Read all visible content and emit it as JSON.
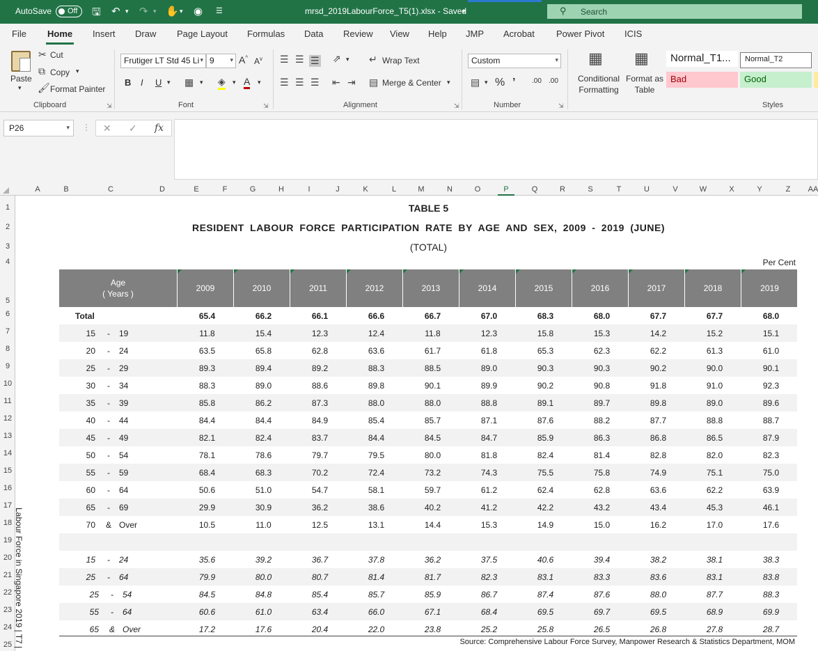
{
  "titlebar": {
    "autosave_label": "AutoSave",
    "autosave_state": "Off",
    "filename": "mrsd_2019LabourForce_T5(1).xlsx  -  Saved",
    "search_placeholder": "Search"
  },
  "menu": {
    "tabs": [
      "File",
      "Home",
      "Insert",
      "Draw",
      "Page Layout",
      "Formulas",
      "Data",
      "Review",
      "View",
      "Help",
      "JMP",
      "Acrobat",
      "Power Pivot",
      "ICIS"
    ],
    "active": "Home"
  },
  "ribbon": {
    "clipboard": {
      "paste": "Paste",
      "cut": "Cut",
      "copy": "Copy",
      "format_painter": "Format Painter",
      "label": "Clipboard"
    },
    "font": {
      "font_name": "Frutiger LT Std 45 Li",
      "font_size": "9",
      "label": "Font",
      "bold": "B",
      "italic": "I",
      "underline": "U"
    },
    "alignment": {
      "wrap_text": "Wrap Text",
      "merge_center": "Merge & Center",
      "label": "Alignment"
    },
    "number": {
      "format": "Custom",
      "label": "Number"
    },
    "styles": {
      "conditional_formatting": "Conditional Formatting",
      "format_as_table": "Format as Table",
      "normal_t1": "Normal_T1...",
      "normal_t2": "Normal_T2",
      "bad": "Bad",
      "good": "Good",
      "label": "Styles",
      "bad_bg": "#ffc7ce",
      "bad_fg": "#9c0006",
      "good_bg": "#c6efce",
      "good_fg": "#006100"
    }
  },
  "formula_bar": {
    "name_box": "P26",
    "fx": "fx",
    "value": ""
  },
  "columns": [
    "A",
    "B",
    "C",
    "D",
    "E",
    "F",
    "G",
    "H",
    "I",
    "J",
    "K",
    "L",
    "M",
    "N",
    "O",
    "P",
    "Q",
    "R",
    "S",
    "T",
    "U",
    "V",
    "W",
    "X",
    "Y",
    "Z",
    "AA"
  ],
  "selected_column": "P",
  "rows": [
    "1",
    "2",
    "3",
    "4",
    "5",
    "6",
    "7",
    "8",
    "9",
    "10",
    "11",
    "12",
    "13",
    "14",
    "15",
    "16",
    "17",
    "18",
    "19",
    "20",
    "21",
    "22",
    "23",
    "24",
    "25"
  ],
  "sheet": {
    "title1": "TABLE  5",
    "title2": "RESIDENT  LABOUR  FORCE  PARTICIPATION  RATE  BY  AGE  AND  SEX,  2009 - 2019  (JUNE)",
    "title3": "(TOTAL)",
    "unit": "Per Cent",
    "age_header_line1": "Age",
    "age_header_line2": "( Years )",
    "years": [
      "2009",
      "2010",
      "2011",
      "2012",
      "2013",
      "2014",
      "2015",
      "2016",
      "2017",
      "2018",
      "2019"
    ],
    "total_label": "Total",
    "total_values": [
      "65.4",
      "66.2",
      "66.1",
      "66.6",
      "66.7",
      "67.0",
      "68.3",
      "68.0",
      "67.7",
      "67.7",
      "68.0"
    ],
    "age_rows": [
      {
        "lo": "15",
        "sep": "-",
        "hi": "19",
        "values": [
          "11.8",
          "15.4",
          "12.3",
          "12.4",
          "11.8",
          "12.3",
          "15.8",
          "15.3",
          "14.2",
          "15.2",
          "15.1"
        ]
      },
      {
        "lo": "20",
        "sep": "-",
        "hi": "24",
        "values": [
          "63.5",
          "65.8",
          "62.8",
          "63.6",
          "61.7",
          "61.8",
          "65.3",
          "62.3",
          "62.2",
          "61.3",
          "61.0"
        ]
      },
      {
        "lo": "25",
        "sep": "-",
        "hi": "29",
        "values": [
          "89.3",
          "89.4",
          "89.2",
          "88.3",
          "88.5",
          "89.0",
          "90.3",
          "90.3",
          "90.2",
          "90.0",
          "90.1"
        ]
      },
      {
        "lo": "30",
        "sep": "-",
        "hi": "34",
        "values": [
          "88.3",
          "89.0",
          "88.6",
          "89.8",
          "90.1",
          "89.9",
          "90.2",
          "90.8",
          "91.8",
          "91.0",
          "92.3"
        ]
      },
      {
        "lo": "35",
        "sep": "-",
        "hi": "39",
        "values": [
          "85.8",
          "86.2",
          "87.3",
          "88.0",
          "88.0",
          "88.8",
          "89.1",
          "89.7",
          "89.8",
          "89.0",
          "89.6"
        ]
      },
      {
        "lo": "40",
        "sep": "-",
        "hi": "44",
        "values": [
          "84.4",
          "84.4",
          "84.9",
          "85.4",
          "85.7",
          "87.1",
          "87.6",
          "88.2",
          "87.7",
          "88.8",
          "88.7"
        ]
      },
      {
        "lo": "45",
        "sep": "-",
        "hi": "49",
        "values": [
          "82.1",
          "82.4",
          "83.7",
          "84.4",
          "84.5",
          "84.7",
          "85.9",
          "86.3",
          "86.8",
          "86.5",
          "87.9"
        ]
      },
      {
        "lo": "50",
        "sep": "-",
        "hi": "54",
        "values": [
          "78.1",
          "78.6",
          "79.7",
          "79.5",
          "80.0",
          "81.8",
          "82.4",
          "81.4",
          "82.8",
          "82.0",
          "82.3"
        ]
      },
      {
        "lo": "55",
        "sep": "-",
        "hi": "59",
        "values": [
          "68.4",
          "68.3",
          "70.2",
          "72.4",
          "73.2",
          "74.3",
          "75.5",
          "75.8",
          "74.9",
          "75.1",
          "75.0"
        ]
      },
      {
        "lo": "60",
        "sep": "-",
        "hi": "64",
        "values": [
          "50.6",
          "51.0",
          "54.7",
          "58.1",
          "59.7",
          "61.2",
          "62.4",
          "62.8",
          "63.6",
          "62.2",
          "63.9"
        ]
      },
      {
        "lo": "65",
        "sep": "-",
        "hi": "69",
        "values": [
          "29.9",
          "30.9",
          "36.2",
          "38.6",
          "40.2",
          "41.2",
          "42.2",
          "43.2",
          "43.4",
          "45.3",
          "46.1"
        ]
      },
      {
        "lo": "70",
        "sep": "&",
        "hi": "Over",
        "values": [
          "10.5",
          "11.0",
          "12.5",
          "13.1",
          "14.4",
          "15.3",
          "14.9",
          "15.0",
          "16.2",
          "17.0",
          "17.6"
        ]
      }
    ],
    "group_rows": [
      {
        "lo": "15",
        "sep": "-",
        "hi": "24",
        "values": [
          "35.6",
          "39.2",
          "36.7",
          "37.8",
          "36.2",
          "37.5",
          "40.6",
          "39.4",
          "38.2",
          "38.1",
          "38.3"
        ]
      },
      {
        "lo": "25",
        "sep": "-",
        "hi": "64",
        "values": [
          "79.9",
          "80.0",
          "80.7",
          "81.4",
          "81.7",
          "82.3",
          "83.1",
          "83.3",
          "83.6",
          "83.1",
          "83.8"
        ]
      },
      {
        "lo": "25",
        "sep": "-",
        "hi": "54",
        "values": [
          "84.5",
          "84.8",
          "85.4",
          "85.7",
          "85.9",
          "86.7",
          "87.4",
          "87.6",
          "88.0",
          "87.7",
          "88.3"
        ]
      },
      {
        "lo": "55",
        "sep": "-",
        "hi": "64",
        "values": [
          "60.6",
          "61.0",
          "63.4",
          "66.0",
          "67.1",
          "68.4",
          "69.5",
          "69.7",
          "69.5",
          "68.9",
          "69.9"
        ]
      },
      {
        "lo": "65",
        "sep": "&",
        "hi": "Over",
        "values": [
          "17.2",
          "17.6",
          "20.4",
          "22.0",
          "23.8",
          "25.2",
          "25.8",
          "26.5",
          "26.8",
          "27.8",
          "28.7"
        ]
      }
    ],
    "source": "Source:  Comprehensive Labour Force Survey, Manpower Research & Statistics Department, MOM",
    "side_label": "Labour Force in Singapore 2019 | T7 |"
  }
}
